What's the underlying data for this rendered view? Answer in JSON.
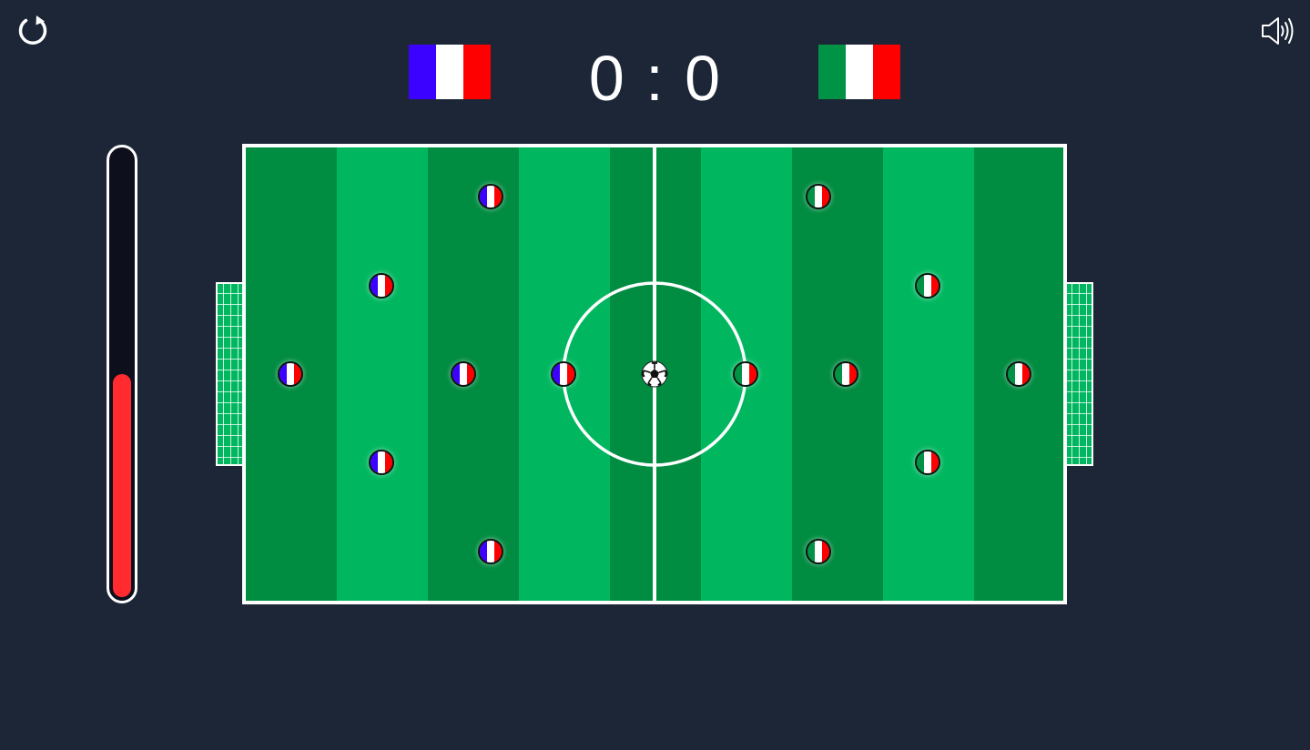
{
  "controls": {
    "restart_icon": "restart-icon",
    "sound_icon": "speaker-icon"
  },
  "scoreboard": {
    "home_score": "0",
    "separator": ":",
    "away_score": "0",
    "home_team": {
      "flag_colors": [
        "#3c02ff",
        "#ffffff",
        "#ff0000"
      ]
    },
    "away_team": {
      "flag_colors": [
        "#009245",
        "#ffffff",
        "#ff0000"
      ]
    }
  },
  "power_meter": {
    "level": 0.5,
    "fill_color": "#ff2b2f"
  },
  "pitch": {
    "stripe_colors": [
      "#008c41",
      "#00b760"
    ],
    "line_color": "#ffffff"
  },
  "players": {
    "home": [
      {
        "row": 1,
        "col": 1
      },
      {
        "row": 2,
        "col": 2
      },
      {
        "row": 3,
        "col": 0
      },
      {
        "row": 3,
        "col": 3
      },
      {
        "row": 3,
        "col": 4
      },
      {
        "row": 4,
        "col": 2
      },
      {
        "row": 5,
        "col": 1
      }
    ],
    "away": [
      {
        "row": 1,
        "col": 1
      },
      {
        "row": 2,
        "col": 2
      },
      {
        "row": 3,
        "col": 0
      },
      {
        "row": 3,
        "col": 3
      },
      {
        "row": 3,
        "col": 4
      },
      {
        "row": 4,
        "col": 2
      },
      {
        "row": 5,
        "col": 1
      }
    ]
  },
  "ball": {
    "icon": "soccer-ball-icon"
  }
}
